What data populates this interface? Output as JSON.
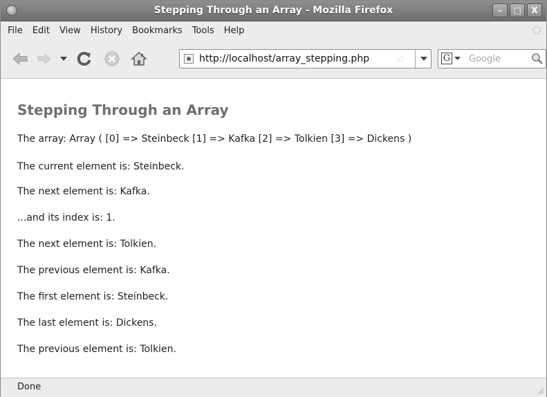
{
  "window": {
    "title": "Stepping Through an Array - Mozilla Firefox",
    "buttons": {
      "minimize": "–",
      "maximize": "□",
      "close": "X"
    }
  },
  "menu": {
    "items": [
      "File",
      "Edit",
      "View",
      "History",
      "Bookmarks",
      "Tools",
      "Help"
    ]
  },
  "navbar": {
    "url": "http://localhost/array_stepping.php",
    "search_engine_letter": "G",
    "search_placeholder": "Google"
  },
  "page": {
    "heading": "Stepping Through an Array",
    "lines": [
      "The array: Array ( [0] => Steinbeck [1] => Kafka [2] => Tolkien [3] => Dickens )",
      "The current element is: Steinbeck.",
      "The next element is: Kafka.",
      "...and its index is: 1.",
      "The next element is: Tolkien.",
      "The previous element is: Kafka.",
      "The first element is: Steinbeck.",
      "The last element is: Dickens.",
      "The previous element is: Tolkien."
    ]
  },
  "status": {
    "text": "Done"
  },
  "colors": {
    "title_bar": "#7d7d7d",
    "heading": "#6f6f6f",
    "chrome": "#ececec"
  }
}
